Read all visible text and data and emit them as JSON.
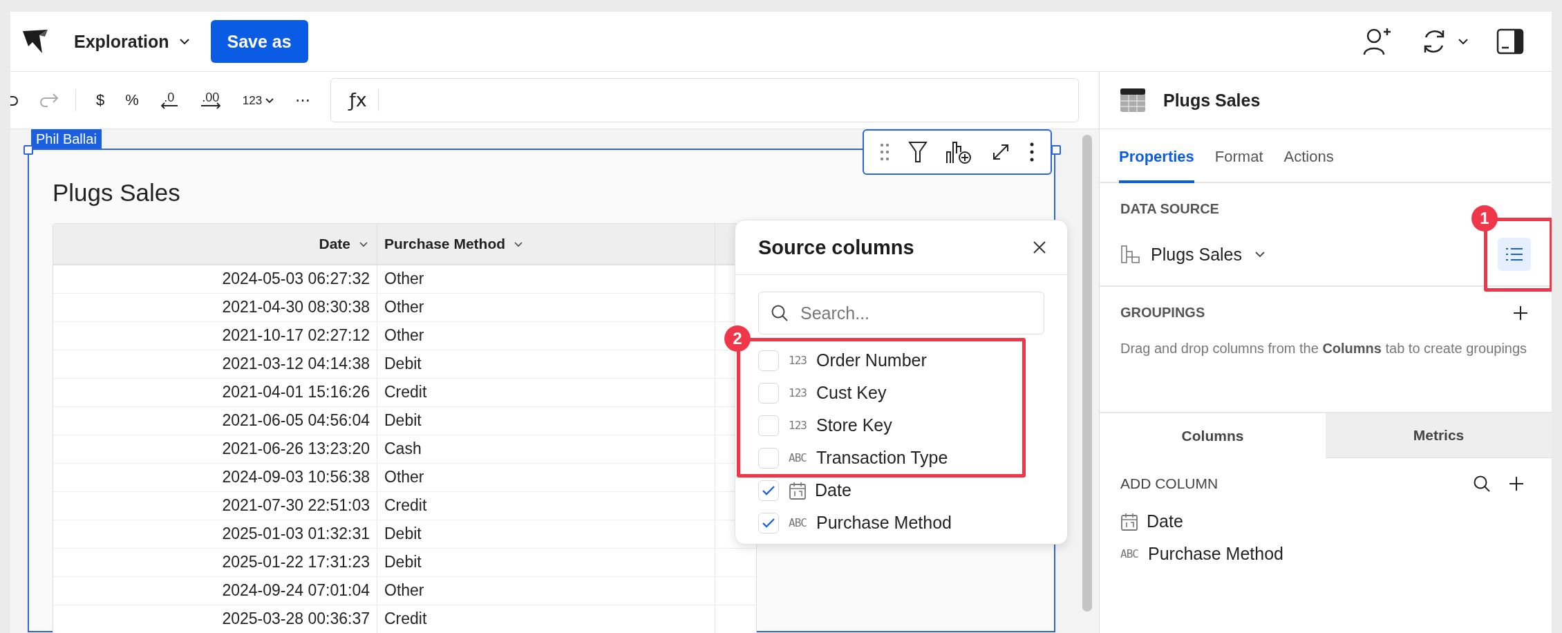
{
  "app_bar": {
    "title": "Exploration",
    "save_button": "Save as"
  },
  "toolbar": {
    "history": [
      {
        "kind": "undo",
        "disabled": false
      },
      {
        "kind": "redo",
        "disabled": true
      }
    ],
    "format_buttons": [
      {
        "label": "$",
        "kind": "plain"
      },
      {
        "label": "%",
        "kind": "plain"
      },
      {
        "label": ".0",
        "kind": "decrease"
      },
      {
        "label": ".00",
        "kind": "increase"
      },
      {
        "label": "123",
        "kind": "menu"
      },
      {
        "label": "⋯",
        "kind": "plain"
      }
    ],
    "formula_bar": {
      "fx": "ƒx"
    }
  },
  "element": {
    "editor_tag": "Phil Ballai",
    "title": "Plugs Sales",
    "table": {
      "columns": [
        {
          "label": "Date"
        },
        {
          "label": "Purchase Method"
        }
      ],
      "rows": [
        [
          "2024-05-03 06:27:32",
          "Other"
        ],
        [
          "2021-04-30 08:30:38",
          "Other"
        ],
        [
          "2021-10-17 02:27:12",
          "Other"
        ],
        [
          "2021-03-12 04:14:38",
          "Debit"
        ],
        [
          "2021-04-01 15:16:26",
          "Credit"
        ],
        [
          "2021-06-05 04:56:04",
          "Debit"
        ],
        [
          "2021-06-26 13:23:20",
          "Cash"
        ],
        [
          "2024-09-03 10:56:38",
          "Other"
        ],
        [
          "2021-07-30 22:51:03",
          "Credit"
        ],
        [
          "2025-01-03 01:32:31",
          "Debit"
        ],
        [
          "2025-01-22 17:31:23",
          "Debit"
        ],
        [
          "2024-09-24 07:01:04",
          "Other"
        ],
        [
          "2025-03-28 00:36:37",
          "Credit"
        ]
      ]
    }
  },
  "source_columns_popup": {
    "title": "Source columns",
    "search": {
      "placeholder": "Search..."
    },
    "annotation": "2",
    "items": [
      {
        "name": "Order Number",
        "kind": "label",
        "type_label": "123",
        "checked": false
      },
      {
        "name": "Cust Key",
        "kind": "label",
        "type_label": "123",
        "checked": false
      },
      {
        "name": "Store Key",
        "kind": "label",
        "type_label": "123",
        "checked": false
      },
      {
        "name": "Transaction Type",
        "kind": "label",
        "type_label": "ABC",
        "checked": false
      },
      {
        "name": "Date",
        "kind": "date",
        "checked": true
      },
      {
        "name": "Purchase Method",
        "kind": "label",
        "type_label": "ABC",
        "checked": true
      }
    ]
  },
  "right_panel": {
    "title": "Plugs Sales",
    "tabs": [
      {
        "label": "Properties",
        "selected": true
      },
      {
        "label": "Format",
        "selected": false
      },
      {
        "label": "Actions",
        "selected": false
      }
    ],
    "data_source": {
      "heading": "DATA SOURCE",
      "name": "Plugs Sales",
      "annotation": "1"
    },
    "groupings": {
      "heading": "GROUPINGS",
      "hint": "Drag and drop columns from the **Columns** tab to create groupings"
    },
    "subtabs": [
      {
        "label": "Columns",
        "selected": true
      },
      {
        "label": "Metrics",
        "selected": false
      }
    ],
    "add_column": {
      "heading": "ADD COLUMN"
    },
    "columns": [
      {
        "name": "Date",
        "kind": "date"
      },
      {
        "name": "Purchase Method",
        "kind": "label",
        "type_label": "ABC"
      }
    ]
  }
}
